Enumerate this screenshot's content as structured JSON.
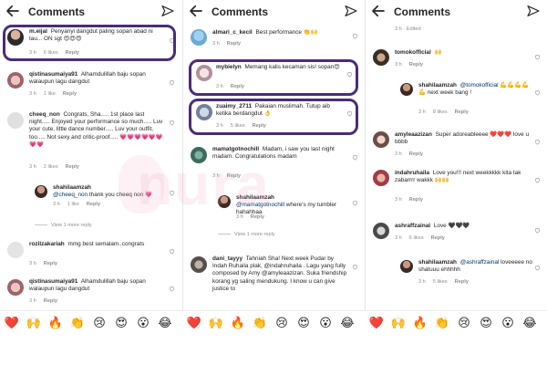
{
  "panels": [
    {
      "title": "Comments",
      "comments": [
        {
          "user": "m.eijal",
          "text": "Penyanyi dangdut paling sopan abad ni tau... ON sgt 😍😍😍",
          "time": "3 h",
          "likes": "6 likes",
          "reply": "Reply"
        },
        {
          "user": "qistinasumaiya91",
          "text": "Alhamdulillah baju sopan walaupun lagu dangdut",
          "time": "3 h",
          "likes": "1 like",
          "reply": "Reply"
        },
        {
          "user": "cheeq_non",
          "text": "Congrats, Sha..... 1st place last night..... Enjoyed your performance so much..... Luv your cute, little dance number..... Luv your outfit, too..... Not sexy and critic-proof..... 💗💗💗💗💗💗💗💗",
          "time": "3 h",
          "likes": "2 likes",
          "reply": "Reply"
        },
        {
          "user": "shahilaamzah",
          "mention": "@cheeq_non",
          "text": "thank you cheeq non 💗",
          "time": "3 h",
          "likes": "1 like",
          "reply": "Reply"
        },
        {
          "user": "rozilzakariah",
          "text": "mmg best semalam..congrats",
          "time": "3 h",
          "likes": "",
          "reply": "Reply"
        },
        {
          "user": "qistinasumaiya91",
          "text": "Alhamdulillah baju sopan walaupun lagu dangdut",
          "time": "3 h",
          "likes": "",
          "reply": "Reply"
        }
      ],
      "view_more": "View 1 more reply"
    },
    {
      "comments": [
        {
          "user": "almari_c_kecil",
          "text": "Best performance 👏🙌",
          "time": "3 h",
          "likes": "",
          "reply": "Reply"
        },
        {
          "user": "mybielyn",
          "text": "Memang kalis kecaman sis! sopan😍",
          "time": "3 h",
          "likes": "",
          "reply": "Reply"
        },
        {
          "user": "zuaimy_2711",
          "text": "Pakaian muslimah. Tutup aib ketika berdangdut 👌",
          "time": "3 h",
          "likes": "5 likes",
          "reply": "Reply"
        },
        {
          "user": "mamatgotnochill",
          "text": "Madam, i saw you last night madam. Congratulations madam",
          "time": "3 h",
          "likes": "",
          "reply": "Reply"
        },
        {
          "user": "shahilaamzah",
          "mention": "@mamatgotnochill",
          "text": "where's my tumbler hahahhaa",
          "time": "3 h",
          "likes": "",
          "reply": "Reply"
        },
        {
          "user": "dani_tayyy",
          "text": "Tahniah Sha! Next week Pudar by Indah Ruhaila plak, @indahruhaila . Lagu yang fully composed by Amy @amyleaazizan. Suka friendship korang yg saling mendukung. I know u can give justice to",
          "time": "",
          "likes": "",
          "reply": ""
        }
      ],
      "view_more": "View 1 more reply"
    },
    {
      "edited": "3 h · Edited",
      "comments": [
        {
          "user": "tomokofficial",
          "text": "🙌",
          "time": "3 h",
          "likes": "",
          "reply": "Reply"
        },
        {
          "user": "shahilaamzah",
          "mention": "@tomokofficial",
          "text": "💪💪💪💪💪 next week bang !",
          "time": "3 h",
          "likes": "8 likes",
          "reply": "Reply"
        },
        {
          "user": "amyleaazizan",
          "text": "Super adoreableeee ❤️❤️❤️ love u bbbb",
          "time": "3 h",
          "likes": "",
          "reply": "Reply"
        },
        {
          "user": "indahruhaila",
          "text": "Love you!!! next weekkkkk kita tak zabarrrr wakkk 🙌🙌",
          "time": "3 h",
          "likes": "",
          "reply": "Reply"
        },
        {
          "user": "ashraffzainal",
          "text": "Love 🖤🖤🖤",
          "time": "3 h",
          "likes": "6 likes",
          "reply": "Reply"
        },
        {
          "user": "shahilaamzah",
          "mention": "@ashraffzainal",
          "text": "loveeeee no shatuuu ehhhhh",
          "time": "3 h",
          "likes": "5 likes",
          "reply": "Reply"
        }
      ]
    }
  ],
  "watermark": "nura",
  "emojis": [
    "❤️",
    "🙌",
    "🔥",
    "👏",
    "😢",
    "😍",
    "😮",
    "😂"
  ],
  "colors": {
    "highlight": "#4a2d78",
    "mention": "#00376b",
    "meta": "#8e8e8e"
  }
}
